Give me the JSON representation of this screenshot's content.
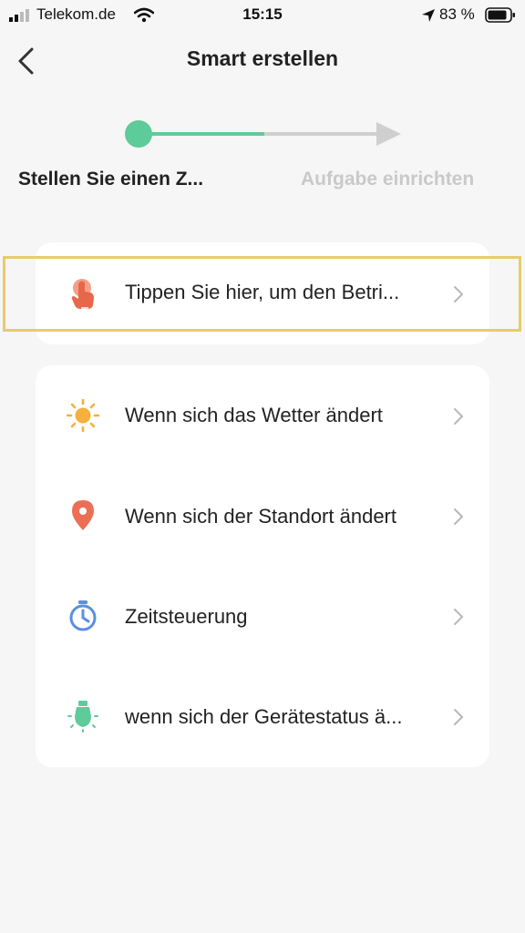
{
  "status_bar": {
    "carrier": "Telekom.de",
    "time": "15:15",
    "battery": "83 %"
  },
  "header": {
    "title": "Smart erstellen"
  },
  "steps": {
    "current": "Stellen Sie einen Z...",
    "next": "Aufgabe einrichten",
    "active_color": "#5ecb9a",
    "inactive_color": "#cfcfcf"
  },
  "manual_card": {
    "label": "Tippen Sie hier, um den Betri...",
    "icon": "tap-hand-icon"
  },
  "conditions": [
    {
      "label": "Wenn sich das Wetter ändert",
      "icon": "sun-icon"
    },
    {
      "label": "Wenn sich der Standort ändert",
      "icon": "location-pin-icon"
    },
    {
      "label": "Zeitsteuerung",
      "icon": "timer-icon"
    },
    {
      "label": "wenn sich der Gerätestatus ä...",
      "icon": "device-light-icon"
    }
  ]
}
